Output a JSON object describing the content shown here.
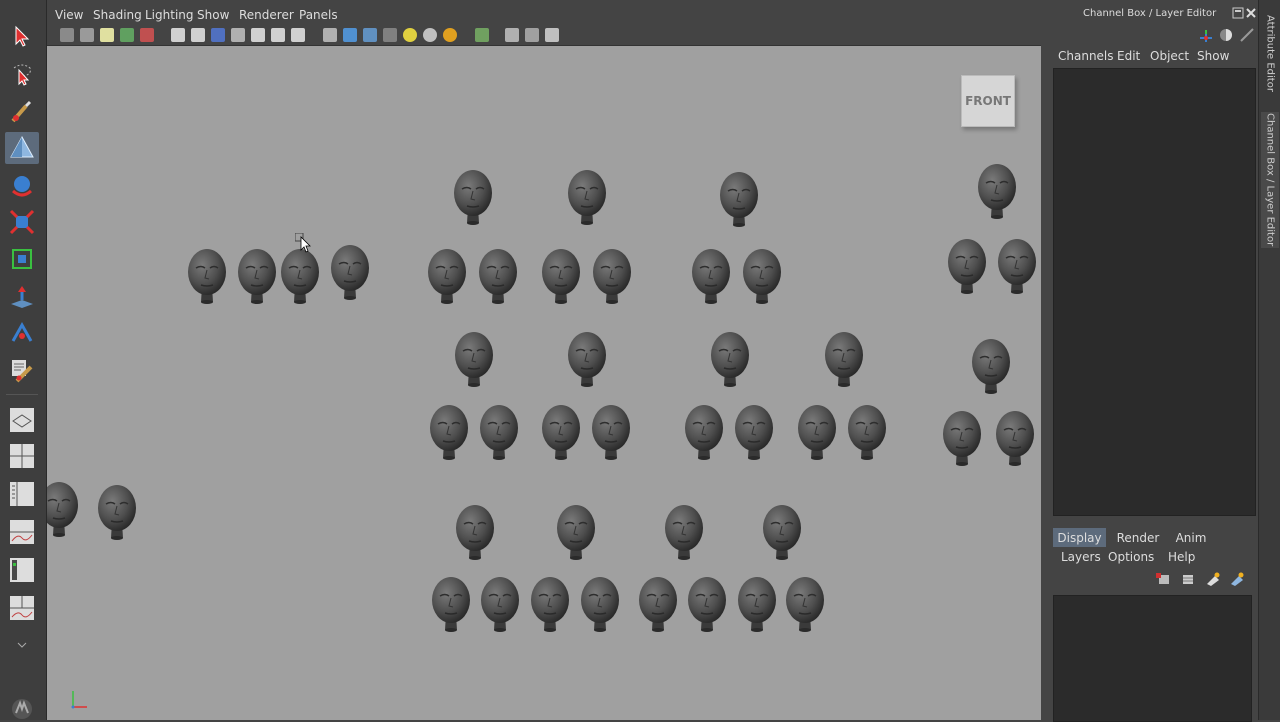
{
  "viewport": {
    "menus": [
      "View",
      "Shading",
      "Lighting",
      "Show",
      "Renderer",
      "Panels"
    ],
    "view_cube_label": "FRONT"
  },
  "channel_box": {
    "title": "Channel Box / Layer Editor",
    "menus": [
      "Channels",
      "Edit",
      "Object",
      "Show"
    ]
  },
  "layer_editor": {
    "tabs": [
      "Display",
      "Render",
      "Anim"
    ],
    "active_tab": "Display",
    "menus": [
      "Layers",
      "Options",
      "Help"
    ]
  },
  "side_tabs": [
    "Attribute Editor",
    "Channel Box / Layer Editor"
  ],
  "colors": {
    "viewport_bg": "#a0a0a0",
    "ui_bg": "#444444",
    "panel_dark": "#2b2b2b",
    "active_tab": "#5d6b7c",
    "head_mesh": "#4e4e4e"
  }
}
